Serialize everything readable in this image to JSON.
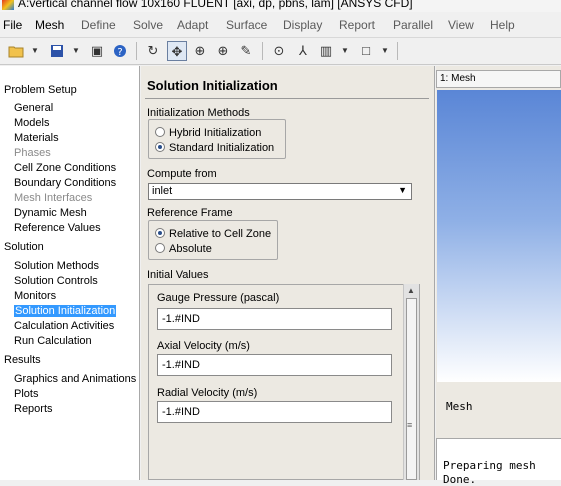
{
  "window": {
    "title": "A:vertical channel flow 10x160 FLUENT  [axi, dp, pbns, lam] [ANSYS CFD]"
  },
  "menubar": [
    "File",
    "Mesh",
    "Define",
    "Solve",
    "Adapt",
    "Surface",
    "Display",
    "Report",
    "Parallel",
    "View",
    "Help"
  ],
  "toolbar": {
    "icons": [
      "open-folder-icon",
      "save-icon",
      "screenshot-icon",
      "help-icon",
      "rotate-icon",
      "pan-icon",
      "zoom-in-icon",
      "zoom-area-icon",
      "probe-icon",
      "fit-icon",
      "measure-icon",
      "layout-icon",
      "window-icon"
    ]
  },
  "nav": {
    "sections": [
      {
        "title": "Problem Setup",
        "items": [
          {
            "label": "General"
          },
          {
            "label": "Models"
          },
          {
            "label": "Materials"
          },
          {
            "label": "Phases",
            "disabled": true
          },
          {
            "label": "Cell Zone Conditions"
          },
          {
            "label": "Boundary Conditions"
          },
          {
            "label": "Mesh Interfaces",
            "disabled": true
          },
          {
            "label": "Dynamic Mesh"
          },
          {
            "label": "Reference Values"
          }
        ]
      },
      {
        "title": "Solution",
        "items": [
          {
            "label": "Solution Methods"
          },
          {
            "label": "Solution Controls"
          },
          {
            "label": "Monitors"
          },
          {
            "label": "Solution Initialization",
            "selected": true
          },
          {
            "label": "Calculation Activities"
          },
          {
            "label": "Run Calculation"
          }
        ]
      },
      {
        "title": "Results",
        "items": [
          {
            "label": "Graphics and Animations"
          },
          {
            "label": "Plots"
          },
          {
            "label": "Reports"
          }
        ]
      }
    ]
  },
  "task": {
    "title": "Solution Initialization",
    "init_methods": {
      "label": "Initialization Methods",
      "options": [
        {
          "label": "Hybrid  Initialization",
          "checked": false
        },
        {
          "label": "Standard Initialization",
          "checked": true
        }
      ]
    },
    "compute_from": {
      "label": "Compute from",
      "value": "inlet"
    },
    "reference_frame": {
      "label": "Reference Frame",
      "options": [
        {
          "label": "Relative to Cell Zone",
          "checked": true
        },
        {
          "label": "Absolute",
          "checked": false
        }
      ]
    },
    "initial_values": {
      "label": "Initial Values",
      "fields": [
        {
          "label": "Gauge Pressure (pascal)",
          "value": "-1.#IND"
        },
        {
          "label": "Axial Velocity (m/s)",
          "value": "-1.#IND"
        },
        {
          "label": "Radial Velocity (m/s)",
          "value": "-1.#IND"
        }
      ]
    }
  },
  "graphics": {
    "tab": "1: Mesh",
    "view_label": "Mesh",
    "console": [
      "Preparing mesh",
      "Done."
    ]
  },
  "colors": {
    "selection": "#3399ff",
    "viewport_top": "#5a86d6",
    "viewport_bottom": "#ffffff"
  }
}
